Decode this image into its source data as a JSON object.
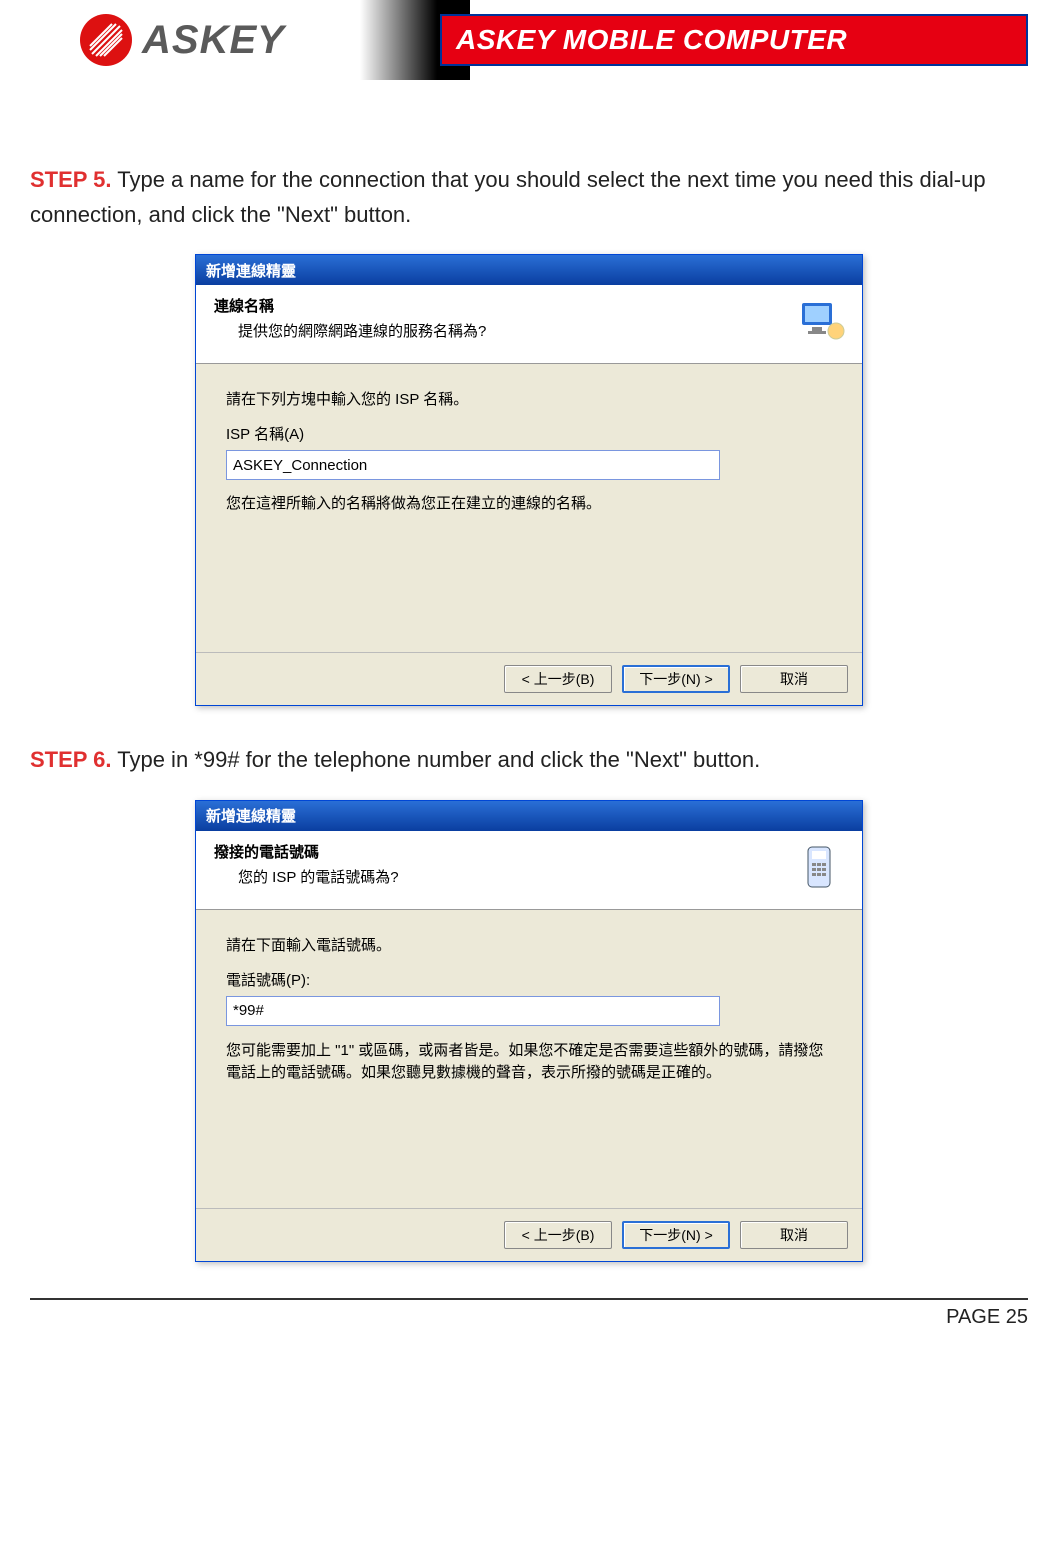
{
  "header": {
    "logo_text": "ASKEY",
    "banner_text": "ASKEY MOBILE COMPUTER"
  },
  "step5": {
    "label": "STEP 5.",
    "text": " Type a name for the connection that you should select the next time you need this dial-up connection, and click the \"Next\" button.",
    "dialog": {
      "title": "新增連線精靈",
      "heading": "連線名稱",
      "subheading": "提供您的網際網路連線的服務名稱為?",
      "line1": "請在下列方塊中輸入您的 ISP 名稱。",
      "field_label": "ISP 名稱(A)",
      "field_value": "ASKEY_Connection",
      "note": "您在這裡所輸入的名稱將做為您正在建立的連線的名稱。",
      "btn_back": "< 上一步(B)",
      "btn_next": "下一步(N) >",
      "btn_cancel": "取消"
    }
  },
  "step6": {
    "label": "STEP 6.",
    "text": " Type in *99# for the telephone number and click the \"Next\" button.",
    "dialog": {
      "title": "新增連線精靈",
      "heading": "撥接的電話號碼",
      "subheading": "您的 ISP 的電話號碼為?",
      "line1": "請在下面輸入電話號碼。",
      "field_label": "電話號碼(P):",
      "field_value": "*99#",
      "note": "您可能需要加上 \"1\" 或區碼，或兩者皆是。如果您不確定是否需要這些額外的號碼，請撥您電話上的電話號碼。如果您聽見數據機的聲音，表示所撥的號碼是正確的。",
      "btn_back": "< 上一步(B)",
      "btn_next": "下一步(N) >",
      "btn_cancel": "取消"
    }
  },
  "footer": {
    "page": "PAGE 25"
  }
}
